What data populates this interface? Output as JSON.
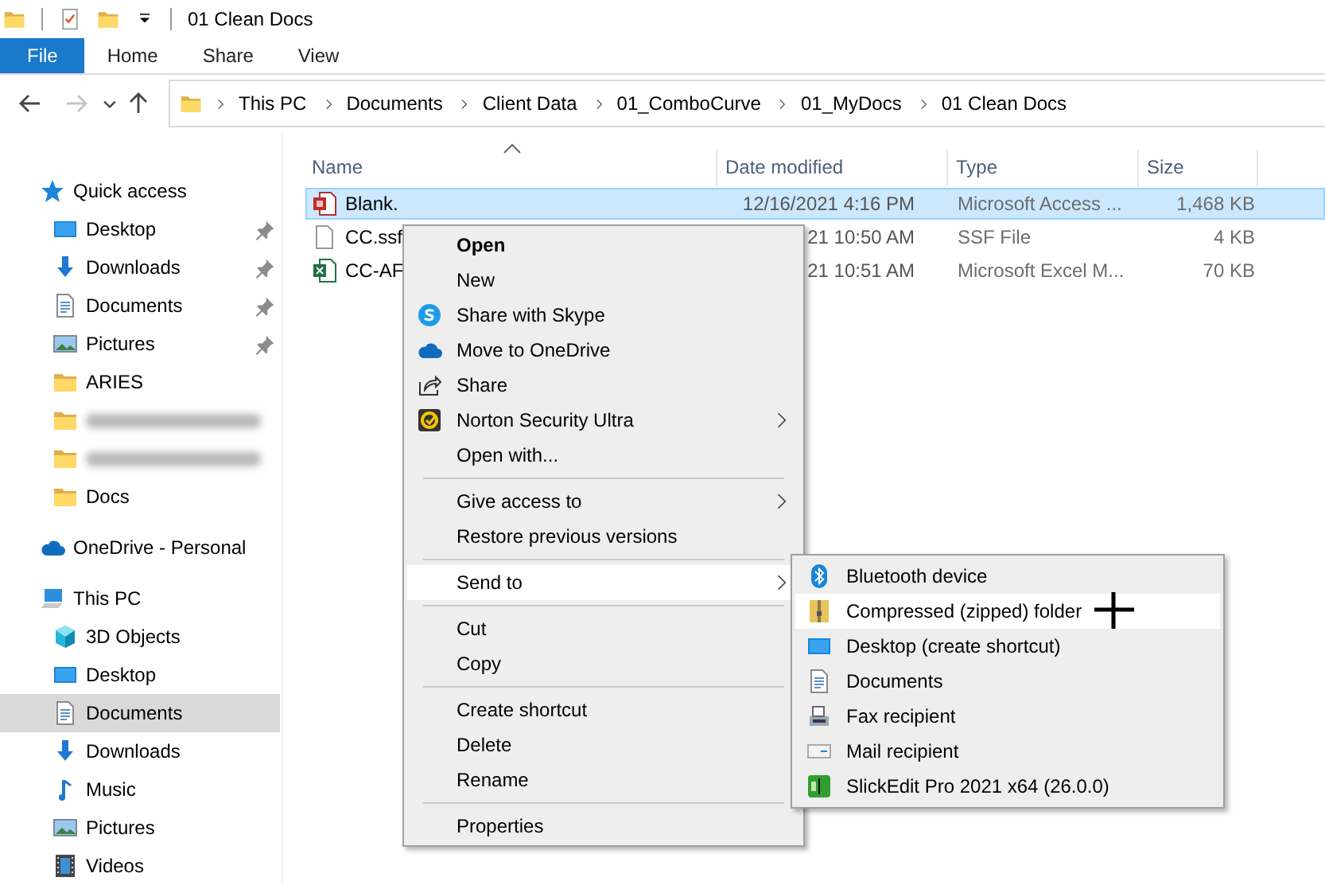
{
  "title_bar": {
    "title": "01 Clean Docs"
  },
  "ribbon_tabs": [
    {
      "label": "File",
      "selected": true
    },
    {
      "label": "Home",
      "selected": false
    },
    {
      "label": "Share",
      "selected": false
    },
    {
      "label": "View",
      "selected": false
    }
  ],
  "nav_buttons": [
    {
      "kind": "back",
      "disabled": false
    },
    {
      "kind": "forward",
      "disabled": true
    },
    {
      "kind": "recent",
      "disabled": false
    },
    {
      "kind": "up",
      "disabled": false
    }
  ],
  "breadcrumbs": [
    "This PC",
    "Documents",
    "Client Data",
    "01_ComboCurve",
    "01_MyDocs",
    "01 Clean Docs"
  ],
  "sidebar": [
    {
      "kind": "star",
      "label": "Quick access",
      "selected": false,
      "children": [
        {
          "kind": "desktop",
          "label": "Desktop",
          "pinned": true,
          "selected": false
        },
        {
          "kind": "download",
          "label": "Downloads",
          "pinned": true,
          "selected": false
        },
        {
          "kind": "document",
          "label": "Documents",
          "pinned": true,
          "selected": false
        },
        {
          "kind": "image",
          "label": "Pictures",
          "pinned": true,
          "selected": false
        },
        {
          "kind": "folder",
          "label": "ARIES",
          "pinned": false,
          "selected": false
        },
        {
          "kind": "folder",
          "blurred": true,
          "pinned": false,
          "selected": false
        },
        {
          "kind": "folder",
          "blurred": true,
          "pinned": false,
          "selected": false
        },
        {
          "kind": "folder",
          "label": "Docs",
          "pinned": false,
          "selected": false
        }
      ]
    },
    {
      "kind": "cloud",
      "label": "OneDrive - Personal",
      "selected": false
    },
    {
      "kind": "computer",
      "label": "This PC",
      "selected": false,
      "children": [
        {
          "kind": "cube",
          "label": "3D Objects",
          "selected": false
        },
        {
          "kind": "desktop",
          "label": "Desktop",
          "selected": false
        },
        {
          "kind": "document",
          "label": "Documents",
          "selected": true
        },
        {
          "kind": "download",
          "label": "Downloads",
          "selected": false
        },
        {
          "kind": "music",
          "label": "Music",
          "selected": false
        },
        {
          "kind": "image",
          "label": "Pictures",
          "selected": false
        },
        {
          "kind": "film",
          "label": "Videos",
          "selected": false
        }
      ]
    }
  ],
  "file_columns": [
    {
      "label": "Name",
      "sorted": true
    },
    {
      "label": "Date modified",
      "sorted": false
    },
    {
      "label": "Type",
      "sorted": false
    },
    {
      "label": "Size",
      "sorted": false
    }
  ],
  "files": [
    {
      "kind": "access",
      "name": "Blank.",
      "date": "12/16/2021 4:16 PM",
      "type": "Microsoft Access ...",
      "size": "1,468 KB",
      "selected": true
    },
    {
      "kind": "file",
      "name": "CC.ssf",
      "date": "21 10:50 AM",
      "type": "SSF File",
      "size": "4 KB",
      "selected": false
    },
    {
      "kind": "excel",
      "name": "CC-AF",
      "date": "21 10:51 AM",
      "type": "Microsoft Excel M...",
      "size": "70 KB",
      "selected": false
    }
  ],
  "context_menu": [
    {
      "kind": "item",
      "label": "Open",
      "default": true,
      "submenu": false,
      "selected": false
    },
    {
      "kind": "item",
      "label": "New",
      "default": false,
      "submenu": false,
      "selected": false
    },
    {
      "kind": "skype",
      "label": "Share with Skype",
      "default": false,
      "submenu": false,
      "selected": false
    },
    {
      "kind": "cloud",
      "label": "Move to OneDrive",
      "default": false,
      "submenu": false,
      "selected": false
    },
    {
      "kind": "share",
      "label": "Share",
      "default": false,
      "submenu": false,
      "selected": false
    },
    {
      "kind": "norton",
      "label": "Norton Security Ultra",
      "default": false,
      "submenu": true,
      "selected": false
    },
    {
      "kind": "item",
      "label": "Open with...",
      "default": false,
      "submenu": false,
      "selected": false
    },
    {
      "kind": "separator"
    },
    {
      "kind": "item",
      "label": "Give access to",
      "default": false,
      "submenu": true,
      "selected": false
    },
    {
      "kind": "item",
      "label": "Restore previous versions",
      "default": false,
      "submenu": false,
      "selected": false
    },
    {
      "kind": "separator"
    },
    {
      "kind": "item",
      "label": "Send to",
      "default": false,
      "submenu": true,
      "selected": true
    },
    {
      "kind": "separator"
    },
    {
      "kind": "item",
      "label": "Cut",
      "default": false,
      "submenu": false,
      "selected": false
    },
    {
      "kind": "item",
      "label": "Copy",
      "default": false,
      "submenu": false,
      "selected": false
    },
    {
      "kind": "separator"
    },
    {
      "kind": "item",
      "label": "Create shortcut",
      "default": false,
      "submenu": false,
      "selected": false
    },
    {
      "kind": "item",
      "label": "Delete",
      "default": false,
      "submenu": false,
      "selected": false
    },
    {
      "kind": "item",
      "label": "Rename",
      "default": false,
      "submenu": false,
      "selected": false
    },
    {
      "kind": "separator"
    },
    {
      "kind": "item",
      "label": "Properties",
      "default": false,
      "submenu": false,
      "selected": false
    }
  ],
  "send_to_menu": [
    {
      "kind": "bluetooth",
      "label": "Bluetooth device",
      "selected": false
    },
    {
      "kind": "zip",
      "label": "Compressed (zipped) folder",
      "selected": true
    },
    {
      "kind": "desktop",
      "label": "Desktop (create shortcut)",
      "selected": false
    },
    {
      "kind": "document",
      "label": "Documents",
      "selected": false
    },
    {
      "kind": "fax",
      "label": "Fax recipient",
      "selected": false
    },
    {
      "kind": "mail",
      "label": "Mail recipient",
      "selected": false
    },
    {
      "kind": "app",
      "label": "SlickEdit Pro 2021 x64 (26.0.0)",
      "selected": false
    }
  ]
}
